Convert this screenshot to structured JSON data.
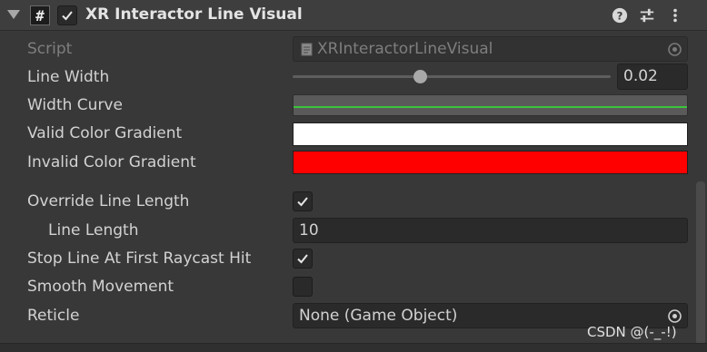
{
  "header": {
    "title": "XR Interactor Line Visual",
    "enabled": true,
    "icons": [
      "foldout-arrow-icon",
      "script-hash-icon",
      "help-icon",
      "presets-icon",
      "more-menu-icon"
    ]
  },
  "script": {
    "label": "Script",
    "value": "XRInteractorLineVisual"
  },
  "line_width": {
    "label": "Line Width",
    "value": "0.02",
    "slider_fraction": 0.4
  },
  "width_curve": {
    "label": "Width Curve",
    "curve_color": "#3cc43c"
  },
  "valid_color_gradient": {
    "label": "Valid Color Gradient",
    "color": "#ffffff"
  },
  "invalid_color_gradient": {
    "label": "Invalid Color Gradient",
    "color": "#ff0000"
  },
  "override_line_length": {
    "label": "Override Line Length",
    "checked": true
  },
  "line_length": {
    "label": "Line Length",
    "value": "10"
  },
  "stop_line_at_first_raycast_hit": {
    "label": "Stop Line At First Raycast Hit",
    "checked": true
  },
  "smooth_movement": {
    "label": "Smooth Movement",
    "checked": false
  },
  "reticle": {
    "label": "Reticle",
    "value": "None (Game Object)"
  },
  "watermark": "CSDN @(-_-!)"
}
